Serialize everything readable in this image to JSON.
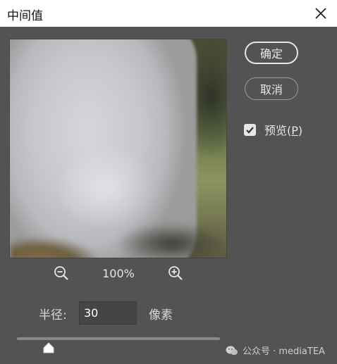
{
  "window": {
    "title": "中间值"
  },
  "buttons": {
    "ok_label": "确定",
    "cancel_label": "取消"
  },
  "preview_option": {
    "label_prefix": "预览(",
    "label_key": "P",
    "label_suffix": ")",
    "checked": true
  },
  "zoom": {
    "level": "100%"
  },
  "radius": {
    "label": "半径:",
    "value": "30",
    "unit": "像素"
  },
  "slider": {
    "value": 30
  },
  "watermark": {
    "text": "公众号 · mediaTEA"
  },
  "icons": {
    "close": "close-icon",
    "zoom_out": "zoom-out-icon",
    "zoom_in": "zoom-in-icon",
    "check": "checkmark-icon",
    "wechat": "wechat-icon"
  },
  "colors": {
    "panel": "#535353",
    "title_bar": "#ffffff",
    "text": "#e6e6e6"
  }
}
